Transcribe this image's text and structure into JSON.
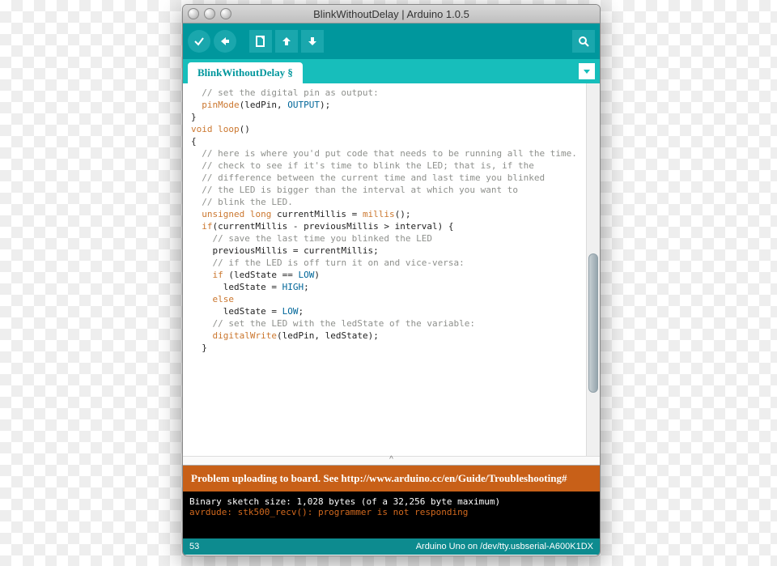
{
  "window": {
    "title": "BlinkWithoutDelay | Arduino 1.0.5"
  },
  "toolbar": {
    "verify_name": "verify-button",
    "upload_name": "upload-button",
    "new_name": "new-button",
    "open_name": "open-button",
    "save_name": "save-button",
    "serial_name": "serial-monitor-button"
  },
  "tab": {
    "label": "BlinkWithoutDelay §"
  },
  "code": {
    "lines": [
      {
        "indent": 1,
        "spans": [
          {
            "cls": "c-comment",
            "t": "// set the digital pin as output:"
          }
        ]
      },
      {
        "indent": 1,
        "spans": [
          {
            "cls": "c-func",
            "t": "pinMode"
          },
          {
            "t": "(ledPin, "
          },
          {
            "cls": "c-const",
            "t": "OUTPUT"
          },
          {
            "t": ");"
          }
        ]
      },
      {
        "indent": 0,
        "spans": [
          {
            "t": "}"
          }
        ]
      },
      {
        "indent": 0,
        "spans": [
          {
            "t": ""
          }
        ]
      },
      {
        "indent": 0,
        "spans": [
          {
            "cls": "c-keyword",
            "t": "void"
          },
          {
            "t": " "
          },
          {
            "cls": "c-func",
            "t": "loop"
          },
          {
            "t": "()"
          }
        ]
      },
      {
        "indent": 0,
        "spans": [
          {
            "t": "{"
          }
        ]
      },
      {
        "indent": 1,
        "spans": [
          {
            "cls": "c-comment",
            "t": "// here is where you'd put code that needs to be running all the time."
          }
        ]
      },
      {
        "indent": 0,
        "spans": [
          {
            "t": ""
          }
        ]
      },
      {
        "indent": 1,
        "spans": [
          {
            "cls": "c-comment",
            "t": "// check to see if it's time to blink the LED; that is, if the"
          }
        ]
      },
      {
        "indent": 1,
        "spans": [
          {
            "cls": "c-comment",
            "t": "// difference between the current time and last time you blinked"
          }
        ]
      },
      {
        "indent": 1,
        "spans": [
          {
            "cls": "c-comment",
            "t": "// the LED is bigger than the interval at which you want to"
          }
        ]
      },
      {
        "indent": 1,
        "spans": [
          {
            "cls": "c-comment",
            "t": "// blink the LED."
          }
        ]
      },
      {
        "indent": 1,
        "spans": [
          {
            "cls": "c-keyword",
            "t": "unsigned long"
          },
          {
            "t": " currentMillis = "
          },
          {
            "cls": "c-func",
            "t": "millis"
          },
          {
            "t": "();"
          }
        ]
      },
      {
        "indent": 0,
        "spans": [
          {
            "t": ""
          }
        ]
      },
      {
        "indent": 1,
        "spans": [
          {
            "cls": "c-keyword",
            "t": "if"
          },
          {
            "t": "(currentMillis - previousMillis > interval) {"
          }
        ]
      },
      {
        "indent": 2,
        "spans": [
          {
            "cls": "c-comment",
            "t": "// save the last time you blinked the LED"
          }
        ]
      },
      {
        "indent": 2,
        "spans": [
          {
            "t": "previousMillis = currentMillis;"
          }
        ]
      },
      {
        "indent": 0,
        "spans": [
          {
            "t": ""
          }
        ]
      },
      {
        "indent": 2,
        "spans": [
          {
            "cls": "c-comment",
            "t": "// if the LED is off turn it on and vice-versa:"
          }
        ]
      },
      {
        "indent": 2,
        "spans": [
          {
            "cls": "c-keyword",
            "t": "if"
          },
          {
            "t": " (ledState == "
          },
          {
            "cls": "c-const",
            "t": "LOW"
          },
          {
            "t": ")"
          }
        ]
      },
      {
        "indent": 3,
        "spans": [
          {
            "t": "ledState = "
          },
          {
            "cls": "c-const",
            "t": "HIGH"
          },
          {
            "t": ";"
          }
        ]
      },
      {
        "indent": 2,
        "spans": [
          {
            "cls": "c-keyword",
            "t": "else"
          }
        ]
      },
      {
        "indent": 3,
        "spans": [
          {
            "t": "ledState = "
          },
          {
            "cls": "c-const",
            "t": "LOW"
          },
          {
            "t": ";"
          }
        ]
      },
      {
        "indent": 0,
        "spans": [
          {
            "t": ""
          }
        ]
      },
      {
        "indent": 2,
        "spans": [
          {
            "cls": "c-comment",
            "t": "// set the LED with the ledState of the variable:"
          }
        ]
      },
      {
        "indent": 2,
        "spans": [
          {
            "cls": "c-func",
            "t": "digitalWrite"
          },
          {
            "t": "(ledPin, ledState);"
          }
        ]
      },
      {
        "indent": 1,
        "spans": [
          {
            "t": "}"
          }
        ]
      }
    ]
  },
  "error": {
    "message": "Problem uploading to board.  See http://www.arduino.cc/en/Guide/Troubleshooting#"
  },
  "console": {
    "line1": "Binary sketch size: 1,028 bytes (of a 32,256 byte maximum)",
    "line2": "avrdude: stk500_recv(): programmer is not responding"
  },
  "status": {
    "line": "53",
    "board": "Arduino Uno on /dev/tty.usbserial-A600K1DX"
  }
}
